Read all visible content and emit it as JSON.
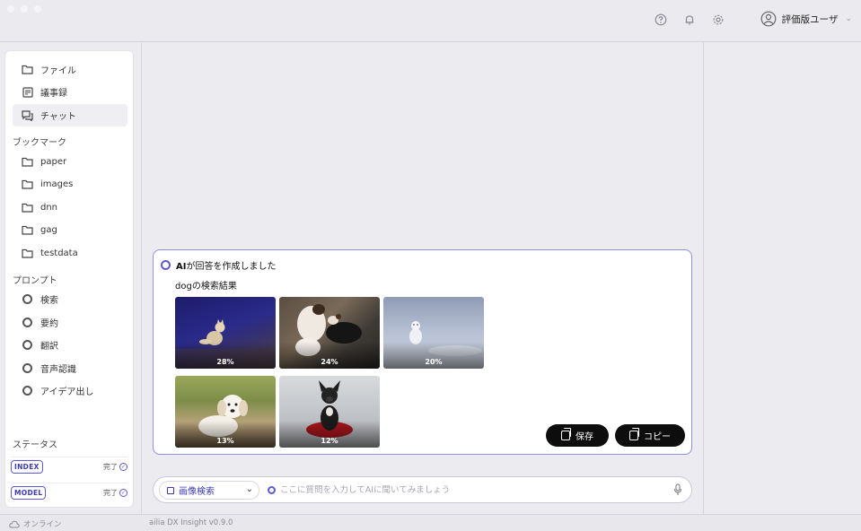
{
  "header": {
    "user_name": "評価版ユーザ"
  },
  "sidebar": {
    "main_items": [
      {
        "label": "ファイル",
        "icon": "folder-icon"
      },
      {
        "label": "議事録",
        "icon": "note-icon"
      },
      {
        "label": "チャット",
        "icon": "chat-icon",
        "active": true
      }
    ],
    "bookmark_title": "ブックマーク",
    "bookmarks": [
      "paper",
      "images",
      "dnn",
      "gag",
      "testdata"
    ],
    "prompt_title": "プロンプト",
    "prompts": [
      "検索",
      "要約",
      "翻訳",
      "音声認識",
      "アイデア出し"
    ],
    "status_title": "ステータス",
    "statuses": [
      {
        "badge": "INDEX",
        "state": "完了"
      },
      {
        "badge": "MODEL",
        "state": "完了"
      }
    ]
  },
  "card": {
    "header_bold": "AI",
    "header_rest": "が回答を作成しました",
    "subtitle": "dogの検索結果",
    "results": [
      {
        "pct": "28%"
      },
      {
        "pct": "24%"
      },
      {
        "pct": "20%"
      },
      {
        "pct": "13%"
      },
      {
        "pct": "12%"
      }
    ],
    "save_label": "保存",
    "copy_label": "コピー"
  },
  "input": {
    "mode": "画像検索",
    "placeholder": "ここに質問を入力してAIに聞いてみましょう"
  },
  "footer": {
    "status": "オンライン",
    "version": "ailia DX Insight v0.9.0"
  },
  "colors": {
    "accent": "#5b5bd0",
    "button_dark": "#0d0d0d"
  }
}
